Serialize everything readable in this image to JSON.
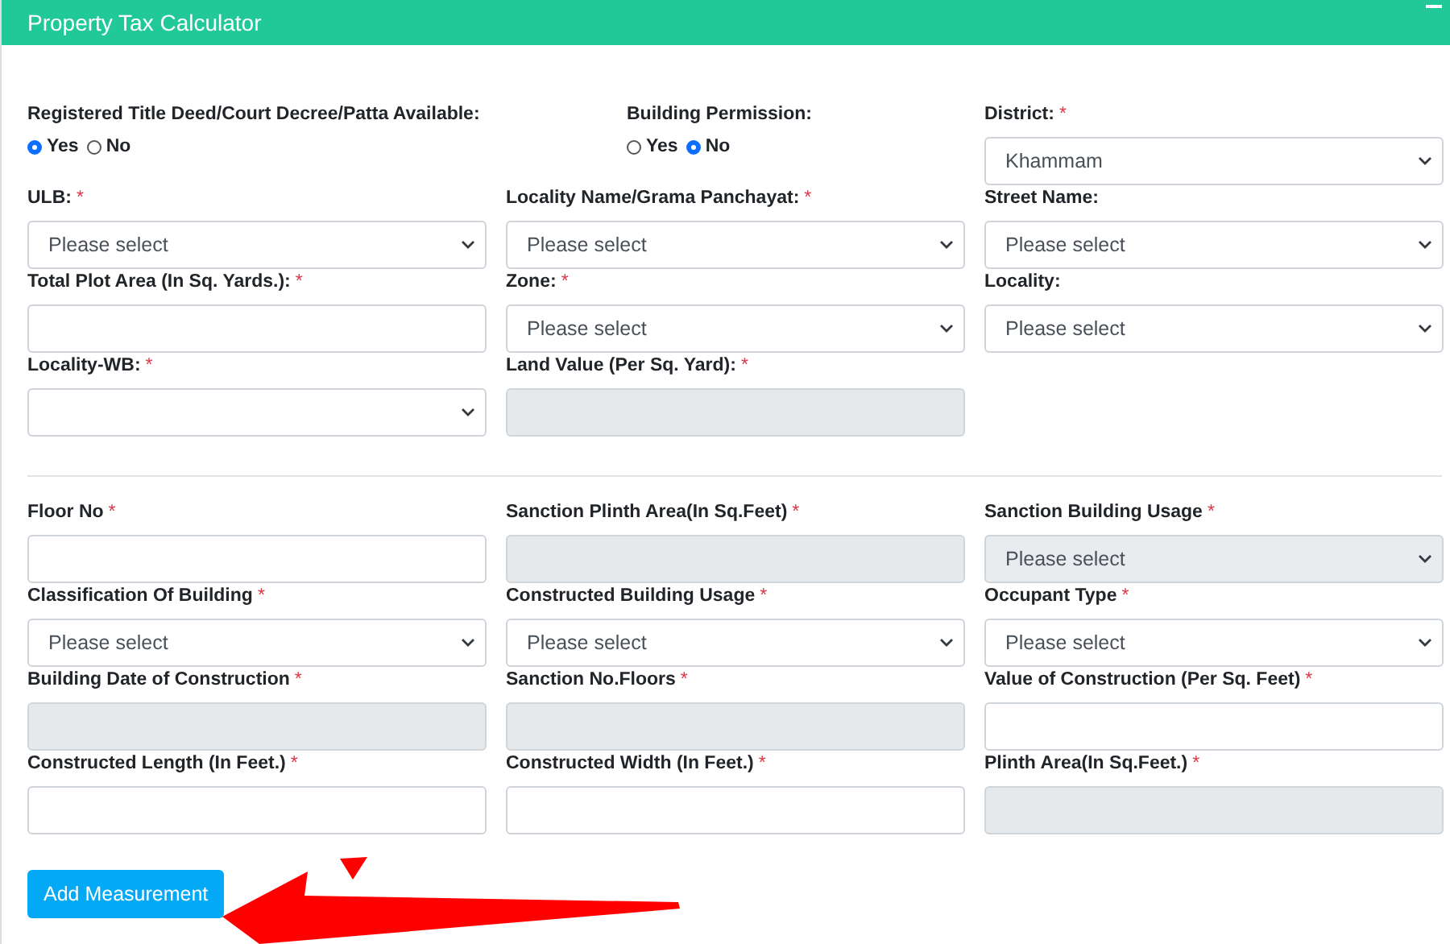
{
  "header": {
    "title": "Property Tax Calculator"
  },
  "sections": [
    {
      "rows": [
        {
          "fields": [
            {
              "kind": "radio",
              "label": "Registered Title Deed/Court Decree/Patta Available:",
              "options": [
                {
                  "label": "Yes",
                  "selected": true
                },
                {
                  "label": "No",
                  "selected": false
                }
              ]
            },
            {
              "kind": "radio",
              "label": "Building Permission:",
              "options": [
                {
                  "label": "Yes",
                  "selected": false
                },
                {
                  "label": "No",
                  "selected": true
                }
              ]
            },
            {
              "kind": "select",
              "label": "District:",
              "mark": "*",
              "value": "Khammam",
              "disabled": false
            }
          ]
        },
        {
          "fields": [
            {
              "kind": "select",
              "label": "ULB:",
              "mark": "*",
              "value": "Please select",
              "disabled": false
            },
            {
              "kind": "select",
              "label": "Locality Name/Grama Panchayat:",
              "mark": "*",
              "value": "Please select",
              "disabled": false
            },
            {
              "kind": "select",
              "label": "Street Name:",
              "value": "Please select",
              "disabled": false
            }
          ]
        },
        {
          "fields": [
            {
              "kind": "input",
              "label": "Total Plot Area (In Sq. Yards.):",
              "mark": "*",
              "disabled": false
            },
            {
              "kind": "select",
              "label": "Zone:",
              "mark": "*",
              "value": "Please select",
              "disabled": false
            },
            {
              "kind": "select",
              "label": "Locality:",
              "value": "Please select",
              "disabled": false
            }
          ]
        },
        {
          "fields": [
            {
              "kind": "select",
              "label": "Locality-WB:",
              "mark": "*",
              "disabled": false
            },
            {
              "kind": "input",
              "label": "Land Value (Per Sq. Yard):",
              "mark": "*",
              "disabled": true
            }
          ]
        }
      ]
    },
    {
      "rows": [
        {
          "fields": [
            {
              "kind": "input",
              "label": "Floor No",
              "mark": "*",
              "disabled": false
            },
            {
              "kind": "input",
              "label": "Sanction Plinth Area(In Sq.Feet)",
              "mark": "*",
              "disabled": true
            },
            {
              "kind": "select",
              "label": "Sanction Building Usage",
              "mark": "*",
              "value": "Please select",
              "disabled": true
            }
          ]
        },
        {
          "fields": [
            {
              "kind": "select",
              "label": "Classification Of Building",
              "mark": "*",
              "value": "Please select",
              "disabled": false
            },
            {
              "kind": "select",
              "label": "Constructed Building Usage",
              "mark": "*",
              "value": "Please select",
              "disabled": false
            },
            {
              "kind": "select",
              "label": "Occupant Type",
              "mark": "*",
              "value": "Please select",
              "disabled": false
            }
          ]
        },
        {
          "fields": [
            {
              "kind": "input",
              "label": "Building Date of Construction",
              "mark": "*",
              "disabled": true
            },
            {
              "kind": "input",
              "label": "Sanction No.Floors",
              "mark": "*",
              "disabled": true
            },
            {
              "kind": "input",
              "label": "Value of Construction (Per Sq. Feet)",
              "mark": "*",
              "disabled": false
            }
          ]
        },
        {
          "fields": [
            {
              "kind": "input",
              "label": "Constructed Length (In Feet.)",
              "mark": "*",
              "disabled": false
            },
            {
              "kind": "input",
              "label": "Constructed Width (In Feet.)",
              "mark": "*",
              "disabled": false
            },
            {
              "kind": "input",
              "label": "Plinth Area(In Sq.Feet.)",
              "mark": "*",
              "disabled": true
            }
          ]
        }
      ]
    }
  ],
  "button": {
    "label": "Add Measurement"
  }
}
